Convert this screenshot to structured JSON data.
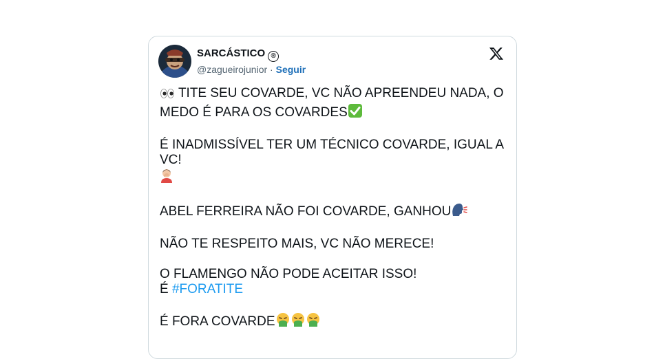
{
  "tweet": {
    "author": {
      "display_name": "SARCÁSTICO",
      "badge": "®",
      "handle": "@zagueirojunior",
      "separator": " · ",
      "follow_label": "Seguir"
    },
    "platform_icon": "x-logo-icon",
    "paragraphs": {
      "p1_line1": "TITE SEU COVARDE, VC NÃO APREENDEU NADA, O",
      "p1_line2": "MEDO É PARA OS COVARDES",
      "p2_line1": "É INADMISSÍVEL TER UM TÉCNICO COVARDE, IGUAL A VC!",
      "p3": "ABEL FERREIRA NÃO FOI COVARDE, GANHOU",
      "p4": "NÃO TE RESPEITO MAIS, VC NÃO MERECE!",
      "p5_line1": "O FLAMENGO NÃO PODE ACEITAR ISSO!",
      "p5_prefix": "É ",
      "p5_hashtag": "#FORATITE",
      "p6": "É FORA COVARDE"
    },
    "colors": {
      "link": "#1d9bf0",
      "follow": "#1d6fb8",
      "text": "#0f1419",
      "muted": "#536471",
      "border": "#cfd9de"
    },
    "emojis": [
      "eyes-emoji",
      "check-mark-emoji",
      "facepalm-emoji",
      "speaking-head-emoji",
      "vomiting-face-emoji"
    ]
  }
}
